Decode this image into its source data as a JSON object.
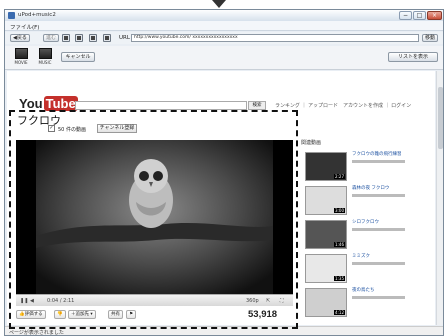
{
  "window": {
    "title": "uPod+music2",
    "min_label": "−",
    "max_label": "□",
    "close_label": "×"
  },
  "menu": {
    "file": "ファイル(F)"
  },
  "nav": {
    "back_label": "戻る",
    "forward_label": "進む",
    "url_label": "URL",
    "url_value": "http://www.youtube.com/ xxxxxxxxxxxxxxxxx",
    "go_label": "移動"
  },
  "toolbar": {
    "movie_label": "MOVIE",
    "music_label": "MUSIC",
    "cancel_label": "キャンセル",
    "list_label": "リストを表示"
  },
  "youtube": {
    "logo_you": "You",
    "logo_tube": "Tube",
    "search_label": "検索",
    "nav_links": "ランキング ｜ アップロード",
    "account_links": "アカウントを作成 ｜ ログイン",
    "video_title": "フクロウ",
    "video_count": "50 件の動画",
    "subscribe_label": "チャンネル登録",
    "time_display": "0:04 / 2:11",
    "quality_label": "360p",
    "rate_label": "評価する",
    "add_label": "追加先",
    "share_label": "共有",
    "view_count": "53,918",
    "related_header": "関連動画",
    "related": [
      {
        "duration": "2:27",
        "title": "フクロウの雛の飛行練習"
      },
      {
        "duration": "3:00",
        "title": "森林の夜 フクロウ"
      },
      {
        "duration": "1:46",
        "title": "シロフクロウ"
      },
      {
        "duration": "1:35",
        "title": "ミミズク"
      },
      {
        "duration": "4:12",
        "title": "夜の鳥たち"
      }
    ]
  },
  "status": {
    "text": "ページが表示されました"
  }
}
